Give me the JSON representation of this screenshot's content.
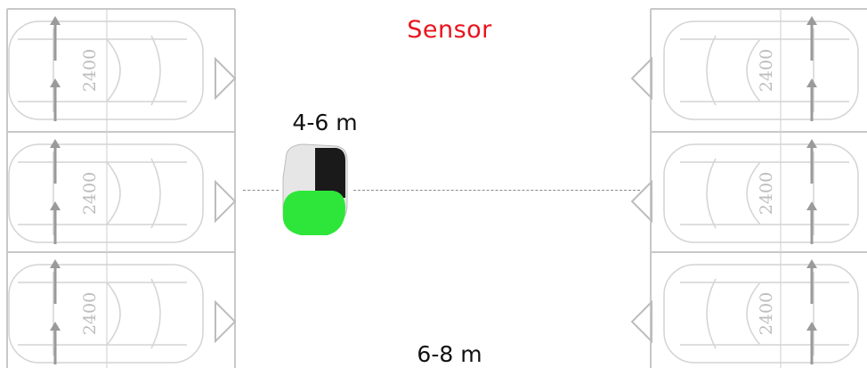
{
  "title": {
    "text": "Sensor",
    "color": "#e8141c"
  },
  "range_near_label": "4-6 m",
  "range_far_label": "6-8 m",
  "bay_width_label": "2400",
  "colors": {
    "bay_lines": "#c8c8c8",
    "sensor_led": "#2ee63a",
    "sensor_body": "#e6e6e6",
    "sensor_panel": "#1a1a1a",
    "car_outline": "#d4d4d4"
  },
  "left_bays": [
    {
      "label": "2400"
    },
    {
      "label": "2400"
    },
    {
      "label": "2400"
    }
  ],
  "right_bays": [
    {
      "label": "2400"
    },
    {
      "label": "2400"
    },
    {
      "label": "2400"
    }
  ]
}
